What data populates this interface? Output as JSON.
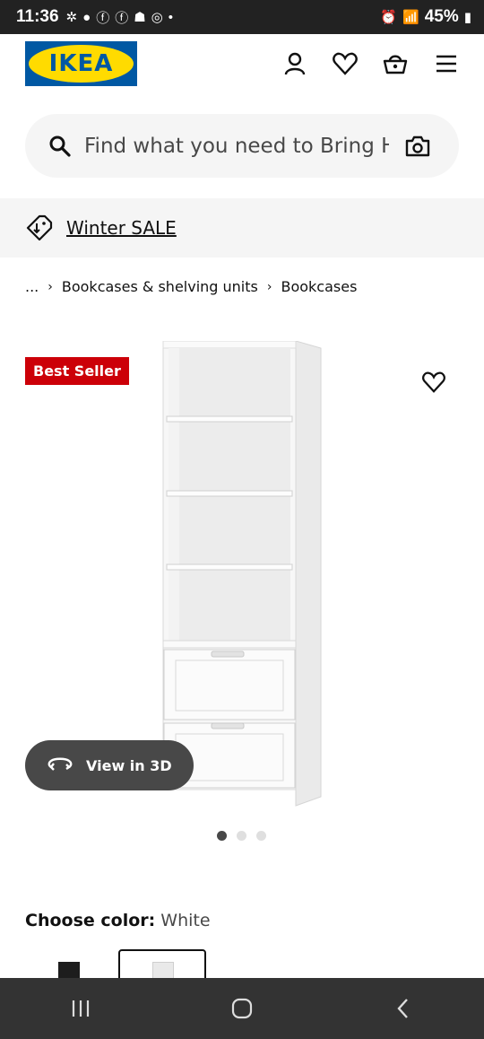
{
  "status": {
    "time": "11:36",
    "battery": "45%",
    "icons": [
      "fan-icon",
      "chat-icon",
      "facebook-icon",
      "facebook-icon",
      "snapchat-icon",
      "instagram-icon",
      "dot-icon",
      "alarm-icon",
      "wifi-icon",
      "signal-icon",
      "battery-icon"
    ]
  },
  "header": {
    "logo_text": "IKEA",
    "icons": [
      "account-icon",
      "heart-icon",
      "basket-icon",
      "menu-icon"
    ]
  },
  "search": {
    "placeholder": "Find what you need to Bring Hc"
  },
  "promo": {
    "label": "Winter SALE"
  },
  "breadcrumb": {
    "items": [
      "...",
      "Bookcases & shelving units",
      "Bookcases"
    ]
  },
  "product": {
    "badge": "Best Seller",
    "view3d_label": "View in 3D",
    "image_count": 3,
    "active_image": 1
  },
  "color": {
    "label": "Choose color:",
    "value": "White",
    "swatches": [
      "Black",
      "White"
    ],
    "selected": "White"
  },
  "colors": {
    "ikea_blue": "#0058a3",
    "ikea_yellow": "#ffdb00",
    "badge_red": "#cc0008"
  }
}
